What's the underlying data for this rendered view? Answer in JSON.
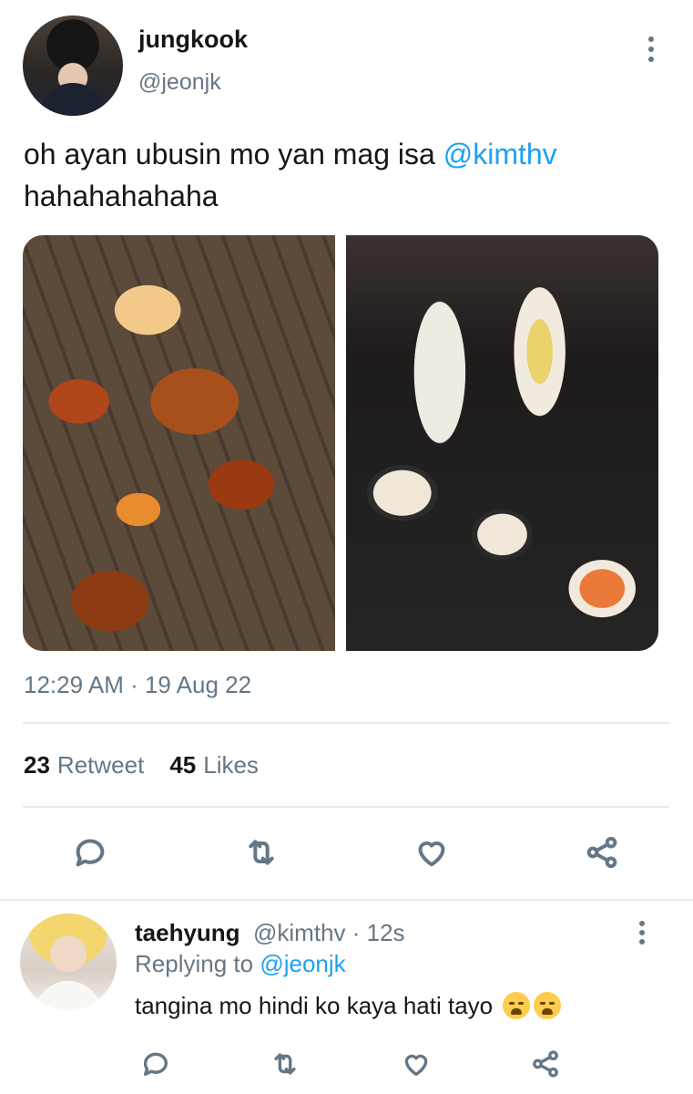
{
  "tweet": {
    "author": {
      "display_name": "jungkook",
      "handle": "@jeonjk",
      "avatar_icon": "profile-photo"
    },
    "text_before": "oh ayan ubusin mo yan mag isa ",
    "mention": "@kimthv",
    "text_after": "hahahahahaha",
    "media": [
      {
        "icon": "fried-chicken-burgers-photo"
      },
      {
        "icon": "sushi-rolls-photo"
      }
    ],
    "timestamp": "12:29 AM · 19 Aug 22",
    "stats": {
      "retweet_count": "23",
      "retweet_label": "Retweet",
      "likes_count": "45",
      "likes_label": "Likes"
    }
  },
  "reply": {
    "author": {
      "display_name": "taehyung",
      "handle_time": "@kimthv · 12s",
      "avatar_icon": "profile-photo"
    },
    "replying_prefix": "Replying to ",
    "replying_handle": "@jeonjk",
    "text": "tangina mo hindi ko kaya hati tayo",
    "emojis": [
      "loudly-crying-face",
      "loudly-crying-face"
    ]
  },
  "actions": [
    "reply-icon",
    "retweet-icon",
    "like-icon",
    "share-icon"
  ],
  "colors": {
    "accent": "#1da1f2",
    "secondary_text": "#657786",
    "divider": "#e6ecf0"
  }
}
